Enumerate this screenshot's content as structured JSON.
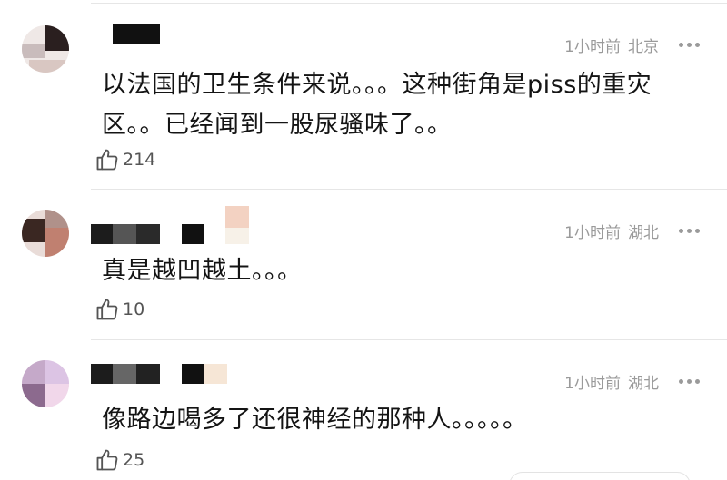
{
  "colors": {
    "meta_text": "#9a9a9a",
    "divider": "#e6e6e6",
    "comment_text": "#141414"
  },
  "comments": [
    {
      "time": "1小时前",
      "location": "北京",
      "text": "以法国的卫生条件来说。。。这种街角是piss的重灾区。。已经闻到一股尿骚味了。。",
      "likes": "214",
      "more_icon": "more-horizontal-icon",
      "like_icon": "thumbs-up-icon"
    },
    {
      "time": "1小时前",
      "location": "湖北",
      "text": "真是越凹越土。。。",
      "likes": "10",
      "more_icon": "more-horizontal-icon",
      "like_icon": "thumbs-up-icon"
    },
    {
      "time": "1小时前",
      "location": "湖北",
      "text": "像路边喝多了还很神经的那种人。。。。。",
      "likes": "25",
      "more_icon": "more-horizontal-icon",
      "like_icon": "thumbs-up-icon"
    }
  ]
}
